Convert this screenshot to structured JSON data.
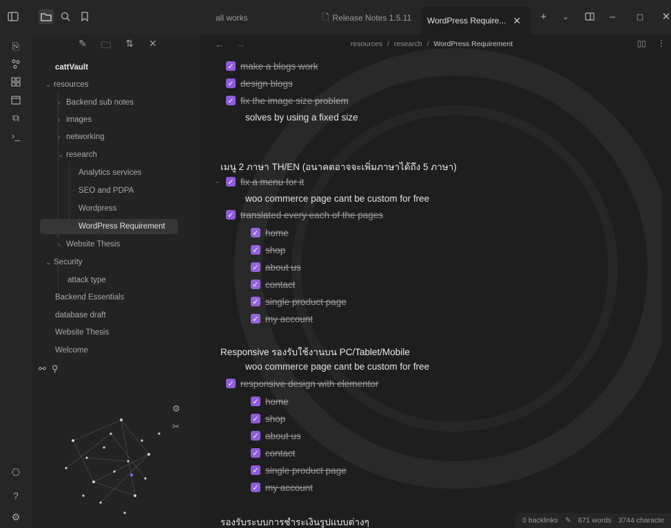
{
  "tabs": {
    "plain": "all works",
    "release": "Release Notes 1.5.11",
    "active": "WordPress Require..."
  },
  "sidebar": {
    "vault": "cattVault",
    "items": [
      {
        "label": "resources"
      },
      {
        "label": "Backend sub notes"
      },
      {
        "label": "images"
      },
      {
        "label": "networking"
      },
      {
        "label": "research"
      },
      {
        "label": "Analytics services"
      },
      {
        "label": "SEO and PDPA"
      },
      {
        "label": "Wordpress"
      },
      {
        "label": "WordPress Requirement"
      },
      {
        "label": "Website Thesis"
      },
      {
        "label": "Security"
      },
      {
        "label": "attack type"
      },
      {
        "label": "Backend Essentials"
      },
      {
        "label": "database draft"
      },
      {
        "label": "Website Thesis"
      },
      {
        "label": "Welcome"
      }
    ]
  },
  "breadcrumb": {
    "part1": "resources",
    "sep": "/",
    "part2": "research",
    "current": "WordPress Requirement"
  },
  "content": {
    "l1": "make a blogs work",
    "l2": "design blogs",
    "l3": "fix the image size problem",
    "l4": "solves by using a fixed size",
    "h1": "เมนู 2 ภาษา TH/EN (อนาคตอาจจะเพิ่มภาษาได้ถึง 5 ภาษา)",
    "l5": "fix a menu for it",
    "l6": "woo commerce page cant be custom for free",
    "l7": "translated every each of the pages",
    "sub1": [
      "home",
      "shop",
      "about us",
      "contact",
      "single product page",
      "my account"
    ],
    "h2": "Responsive รองรับใช้งานบน PC/Tablet/Mobile",
    "l8": "woo commerce page cant be custom for free",
    "l9": "responsive design with elementor",
    "sub2": [
      "home",
      "shop",
      "about us",
      "contact",
      "single product page",
      "my account"
    ],
    "h3": "รองรับระบบการชำระเงินรูปแบบต่างๆ"
  },
  "status": {
    "backlinks": "0 backlinks",
    "words": "671 words",
    "chars": "3744 characte"
  },
  "colors": {
    "accent": "#8f5cdd",
    "bg": "#1e1e1e"
  }
}
